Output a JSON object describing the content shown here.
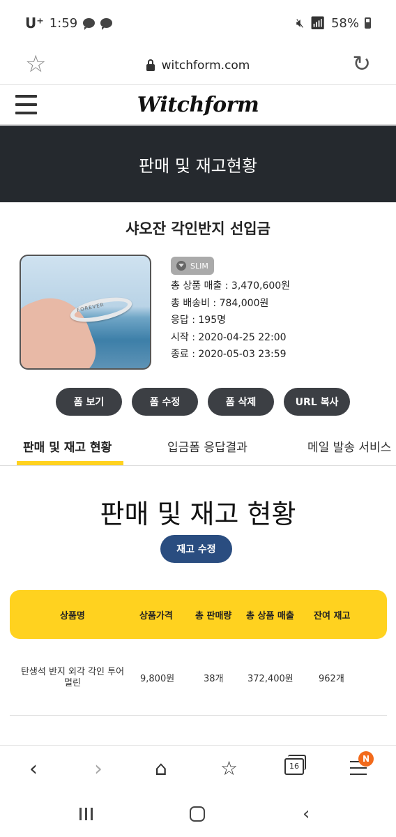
{
  "status_bar": {
    "carrier": "U⁺",
    "time": "1:59",
    "battery": "58%"
  },
  "browser": {
    "url": "witchform.com"
  },
  "site": {
    "logo": "Witchform"
  },
  "banner": {
    "title": "판매 및 재고현황"
  },
  "product": {
    "title": "샤오잔 각인반지 선입금",
    "image_text": "FOREVER",
    "badge": "SLIM",
    "lines": [
      "총 상품 매출 : 3,470,600원",
      "총 배송비 : 784,000원",
      "응답 : 195명",
      "시작 : 2020-04-25 22:00",
      "종료 : 2020-05-03 23:59"
    ]
  },
  "actions": {
    "view": "폼 보기",
    "edit": "폼 수정",
    "delete": "폼 삭제",
    "copy_url": "URL 복사"
  },
  "tabs": [
    "판매 및 재고 현황",
    "입금폼 응답결과",
    "메일 발송 서비스"
  ],
  "section": {
    "title": "판매 및 재고 현황",
    "edit_stock": "재고 수정"
  },
  "table": {
    "headers": [
      "상품명",
      "상품가격",
      "총 판매량",
      "총 상품 매출",
      "잔여 재고"
    ],
    "rows": [
      {
        "name_line1": "탄생석 반지 외각 각인 투어",
        "name_line2": "멀린",
        "price": "9,800원",
        "sold": "38개",
        "revenue": "372,400원",
        "stock": "962개"
      }
    ]
  },
  "bottom_nav": {
    "tab_count": "16",
    "notification_badge": "N"
  },
  "colors": {
    "banner": "#25292e",
    "accent_yellow": "#ffd21f",
    "edit_button": "#2a4d80",
    "action_button": "#3c3f44"
  }
}
